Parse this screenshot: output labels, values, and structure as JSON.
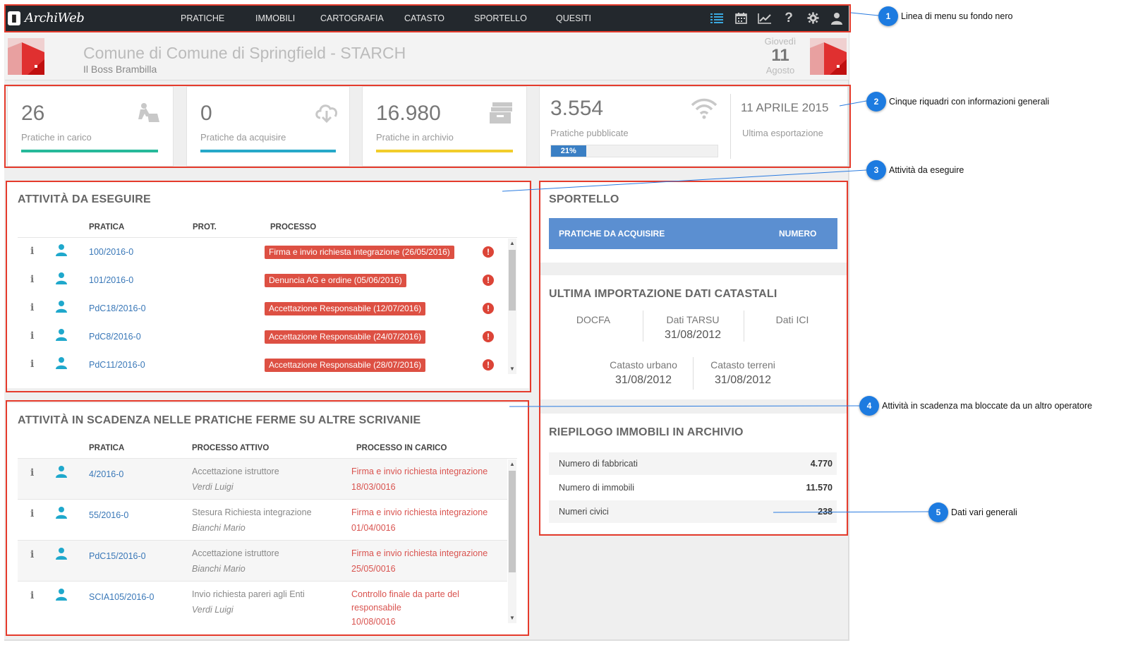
{
  "navbar": {
    "logo_text": "ArchiWeb",
    "items": [
      "PRATICHE",
      "IMMOBILI",
      "CARTOGRAFIA",
      "CATASTO",
      "SPORTELLO",
      "QUESITI"
    ],
    "icons": [
      "list-icon",
      "calendar-icon",
      "chart-icon",
      "help-icon",
      "gear-icon",
      "user-icon"
    ]
  },
  "header": {
    "title": "Comune di Comune di Springfield - STARCH",
    "subtitle": "Il Boss Brambilla",
    "day_name": "Giovedì",
    "day_number": "11",
    "month": "Agosto"
  },
  "stats": [
    {
      "value": "26",
      "label": "Pratiche in carico",
      "color": "#26b99a",
      "icon": "worker-icon"
    },
    {
      "value": "0",
      "label": "Pratiche da acquisire",
      "color": "#26a8c9",
      "icon": "cloud-download-icon"
    },
    {
      "value": "16.980",
      "label": "Pratiche in archivio",
      "color": "#f2cd2b",
      "icon": "archive-icon"
    },
    {
      "value": "3.554",
      "label": "Pratiche pubblicate",
      "progress_label": "21%",
      "progress": 0.21,
      "icon": "wifi-icon"
    }
  ],
  "export": {
    "date": "11 APRILE 2015",
    "label": "Ultima esportazione"
  },
  "attivita": {
    "title": "ATTIVITÀ DA ESEGUIRE",
    "headers": [
      "PRATICA",
      "PROT.",
      "PROCESSO"
    ],
    "rows": [
      {
        "pratica": "100/2016-0",
        "processo": "Firma e invio richiesta integrazione (26/05/2016)"
      },
      {
        "pratica": "101/2016-0",
        "processo": "Denuncia AG e ordine (05/06/2016)"
      },
      {
        "pratica": "PdC18/2016-0",
        "processo": "Accettazione Responsabile (12/07/2016)"
      },
      {
        "pratica": "PdC8/2016-0",
        "processo": "Accettazione Responsabile (24/07/2016)"
      },
      {
        "pratica": "PdC11/2016-0",
        "processo": "Accettazione Responsabile (28/07/2016)"
      }
    ]
  },
  "scadenza": {
    "title": "ATTIVITÀ IN SCADENZA NELLE PRATICHE FERME SU ALTRE SCRIVANIE",
    "headers": [
      "PRATICA",
      "PROCESSO ATTIVO",
      "PROCESSO IN CARICO"
    ],
    "rows": [
      {
        "pratica": "4/2016-0",
        "attivo": "Accettazione istruttore",
        "operatore": "Verdi Luigi",
        "incarico1": "Firma e invio richiesta integrazione",
        "incarico2": "18/03/0016"
      },
      {
        "pratica": "55/2016-0",
        "attivo": "Stesura Richiesta integrazione",
        "operatore": "Bianchi Mario",
        "incarico1": "Firma e invio richiesta integrazione",
        "incarico2": "01/04/0016"
      },
      {
        "pratica": "PdC15/2016-0",
        "attivo": "Accettazione istruttore",
        "operatore": "Bianchi Mario",
        "incarico1": "Firma e invio richiesta integrazione",
        "incarico2": "25/05/0016"
      },
      {
        "pratica": "SCIA105/2016-0",
        "attivo": "Invio richiesta pareri agli Enti",
        "operatore": "Verdi Luigi",
        "incarico1": "Controllo finale da parte del",
        "incarico2": "responsabile",
        "incarico3": "10/08/0016"
      }
    ]
  },
  "sportello": {
    "title": "SPORTELLO",
    "col1": "PRATICHE DA ACQUISIRE",
    "col2": "NUMERO"
  },
  "catasto": {
    "title": "ULTIMA IMPORTAZIONE DATI CATASTALI",
    "docfa": "DOCFA",
    "tarsu_label": "Dati TARSU",
    "tarsu_date": "31/08/2012",
    "ici": "Dati ICI",
    "urbano_label": "Catasto urbano",
    "urbano_date": "31/08/2012",
    "terreni_label": "Catasto terreni",
    "terreni_date": "31/08/2012"
  },
  "riepilogo": {
    "title": "RIEPILOGO IMMOBILI IN ARCHIVIO",
    "rows": [
      {
        "label": "Numero di fabbricati",
        "value": "4.770"
      },
      {
        "label": "Numero di immobili",
        "value": "11.570"
      },
      {
        "label": "Numeri civici",
        "value": "238"
      }
    ]
  },
  "callouts": [
    {
      "num": "1",
      "text": "Linea di menu su fondo nero"
    },
    {
      "num": "2",
      "text": "Cinque riquadri con informazioni generali"
    },
    {
      "num": "3",
      "text": "Attività da eseguire"
    },
    {
      "num": "4",
      "text": "Attività in scadenza ma bloccate da un altro operatore"
    },
    {
      "num": "5",
      "text": "Dati vari generali"
    }
  ],
  "colors": {
    "navbar": "#23282d",
    "accent_blue": "#5b8fd1",
    "badge_red": "#dd5043",
    "highlight_red": "#e53b2c",
    "callout_blue": "#1d7be0"
  }
}
